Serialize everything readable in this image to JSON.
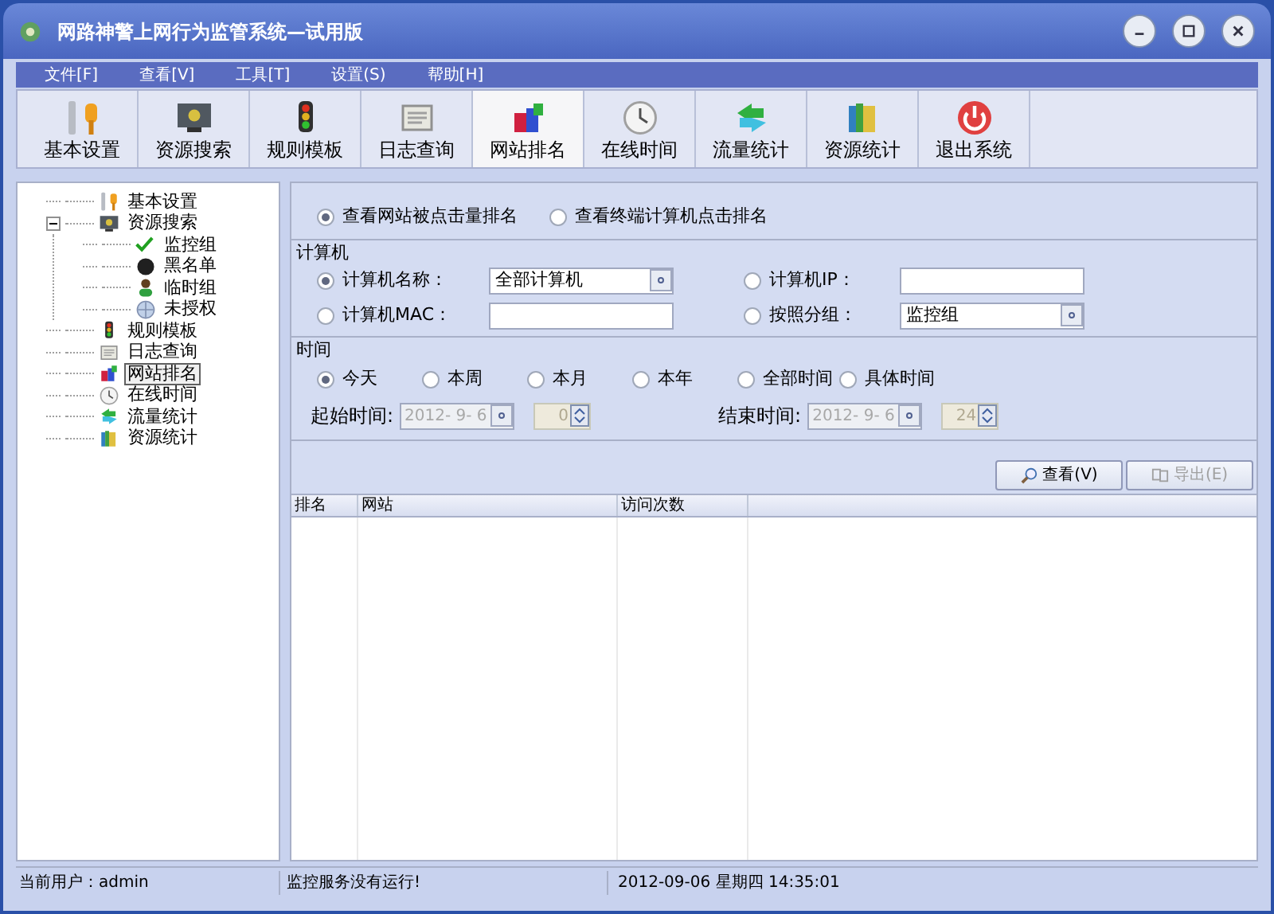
{
  "window": {
    "title": "网路神警上网行为监管系统—试用版"
  },
  "menu": [
    "文件[F]",
    "查看[V]",
    "工具[T]",
    "设置(S)",
    "帮助[H]"
  ],
  "toolbar": [
    {
      "label": "基本设置",
      "kind": "wrench",
      "selected": false
    },
    {
      "label": "资源搜索",
      "kind": "monitor",
      "selected": false
    },
    {
      "label": "规则模板",
      "kind": "light",
      "selected": false
    },
    {
      "label": "日志查询",
      "kind": "note",
      "selected": false
    },
    {
      "label": "网站排名",
      "kind": "rank",
      "selected": true
    },
    {
      "label": "在线时间",
      "kind": "clock",
      "selected": false
    },
    {
      "label": "流量统计",
      "kind": "arrows",
      "selected": false
    },
    {
      "label": "资源统计",
      "kind": "books",
      "selected": false
    },
    {
      "label": "退出系统",
      "kind": "power",
      "selected": false
    }
  ],
  "tree": [
    {
      "label": "基本设置",
      "kind": "wrench",
      "selected": false
    },
    {
      "label": "资源搜索",
      "kind": "monitor",
      "selected": false,
      "expanded": true,
      "children": [
        {
          "label": "监控组",
          "kind": "check",
          "selected": false
        },
        {
          "label": "黑名单",
          "kind": "black",
          "selected": false
        },
        {
          "label": "临时组",
          "kind": "person",
          "selected": false
        },
        {
          "label": "未授权",
          "kind": "globe",
          "selected": false
        }
      ]
    },
    {
      "label": "规则模板",
      "kind": "light",
      "selected": false
    },
    {
      "label": "日志查询",
      "kind": "note",
      "selected": false
    },
    {
      "label": "网站排名",
      "kind": "rank",
      "selected": true
    },
    {
      "label": "在线时间",
      "kind": "clock",
      "selected": false
    },
    {
      "label": "流量统计",
      "kind": "arrows",
      "selected": false
    },
    {
      "label": "资源统计",
      "kind": "books",
      "selected": false
    }
  ],
  "mode": [
    {
      "label": "查看网站被点击量排名",
      "selected": true
    },
    {
      "label": "查看终端计算机点击排名",
      "selected": false
    }
  ],
  "computer": {
    "title": "计算机",
    "filters": [
      {
        "label": "计算机名称：",
        "selected": true,
        "kind": "select",
        "value": "全部计算机"
      },
      {
        "label": "计算机IP：",
        "selected": false,
        "kind": "input"
      },
      {
        "label": "计算机MAC：",
        "selected": false,
        "kind": "input"
      },
      {
        "label": "按照分组：",
        "selected": false,
        "kind": "select",
        "value": "监控组"
      }
    ]
  },
  "time": {
    "title": "时间",
    "ranges": [
      {
        "label": "今天",
        "selected": true
      },
      {
        "label": "本周",
        "selected": false
      },
      {
        "label": "本月",
        "selected": false
      },
      {
        "label": "本年",
        "selected": false
      },
      {
        "label": "全部时间",
        "selected": false
      },
      {
        "label": "具体时间",
        "selected": false
      }
    ],
    "start": {
      "label": "起始时间:",
      "date": "2012- 9- 6",
      "hour": "0",
      "disabled": true
    },
    "end": {
      "label": "结束时间:",
      "date": "2012- 9- 6",
      "hour": "24",
      "disabled": true
    }
  },
  "buttons": [
    {
      "label": "查看(V)",
      "kind": "search",
      "disabled": false
    },
    {
      "label": "导出(E)",
      "kind": "export",
      "disabled": true
    }
  ],
  "table": {
    "columns": [
      "排名",
      "网站",
      "访问次数"
    ]
  },
  "status_bar": [
    "当前用户：admin",
    "监控服务没有运行!",
    "2012-09-06 星期四 14:35:01"
  ]
}
